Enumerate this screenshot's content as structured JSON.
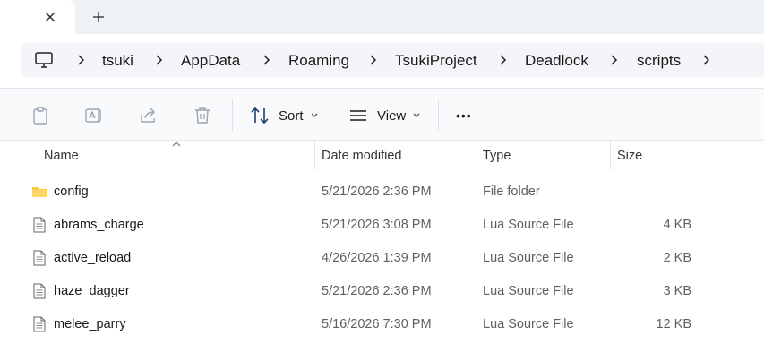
{
  "tabs": {
    "close_glyph": "✕",
    "new_glyph": "+"
  },
  "breadcrumb": {
    "items": [
      "tsuki",
      "AppData",
      "Roaming",
      "TsukiProject",
      "Deadlock",
      "scripts"
    ]
  },
  "toolbar": {
    "sort_label": "Sort",
    "view_label": "View",
    "more_label": "•••"
  },
  "columns": {
    "name": "Name",
    "date": "Date modified",
    "type": "Type",
    "size": "Size"
  },
  "files": [
    {
      "name": "config",
      "date": "5/21/2026 2:36 PM",
      "type": "File folder",
      "size": "",
      "icon": "folder-icon"
    },
    {
      "name": "abrams_charge",
      "date": "5/21/2026 3:08 PM",
      "type": "Lua Source File",
      "size": "4 KB",
      "icon": "file-icon"
    },
    {
      "name": "active_reload",
      "date": "4/26/2026 1:39 PM",
      "type": "Lua Source File",
      "size": "2 KB",
      "icon": "file-icon"
    },
    {
      "name": "haze_dagger",
      "date": "5/21/2026 2:36 PM",
      "type": "Lua Source File",
      "size": "3 KB",
      "icon": "file-icon"
    },
    {
      "name": "melee_parry",
      "date": "5/16/2026 7:30 PM",
      "type": "Lua Source File",
      "size": "12 KB",
      "icon": "file-icon"
    }
  ],
  "colors": {
    "folder": "#f8c84b",
    "accent": "#0067c0",
    "disabled_icon": "#9aa4b1"
  }
}
